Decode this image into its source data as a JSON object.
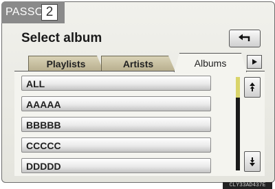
{
  "stage": {
    "name": "PASSO",
    "number": "2"
  },
  "screen": {
    "title": "Select album"
  },
  "tabs": [
    {
      "label": "Playlists",
      "active": false
    },
    {
      "label": "Artists",
      "active": false
    },
    {
      "label": "Albums",
      "active": true
    }
  ],
  "list": {
    "items": [
      "ALL",
      "AAAAA",
      "BBBBB",
      "CCCCC",
      "DDDDD"
    ]
  },
  "icons": {
    "back": "back-arrow-icon",
    "tabs_next": "triangle-right-icon",
    "scroll_up": "scroll-up-icon",
    "scroll_down": "scroll-down-icon"
  },
  "colors": {
    "scroll_thumb": "#d9d46a",
    "tab_inactive": "#c8c0a0",
    "background": "#ecece6"
  },
  "footer": {
    "code": "CLY33AD437E"
  }
}
